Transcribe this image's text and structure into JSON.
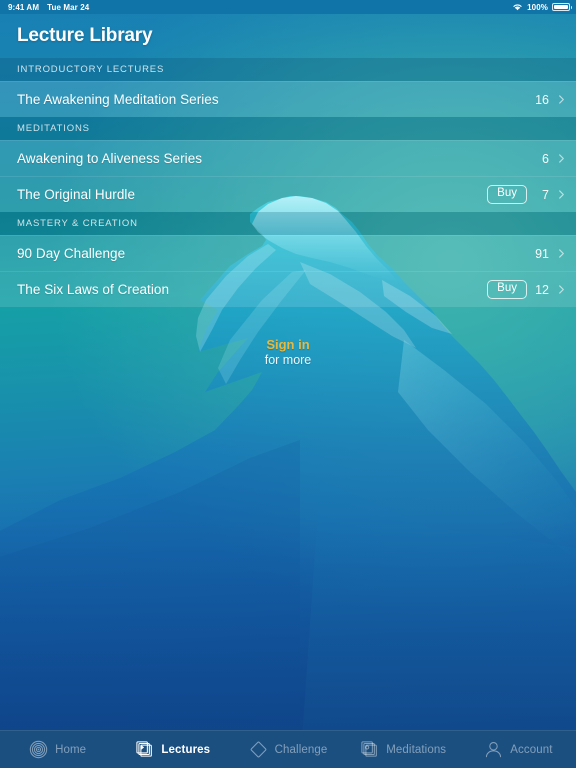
{
  "status_bar": {
    "time": "9:41 AM",
    "date": "Tue Mar 24",
    "battery_percent": "100%",
    "wifi_icon": "wifi-icon",
    "battery_icon": "battery-full-icon"
  },
  "header": {
    "title": "Lecture Library"
  },
  "sections": [
    {
      "title": "INTRODUCTORY LECTURES",
      "rows": [
        {
          "title": "The Awakening Meditation Series",
          "count": "16",
          "buy_label": null,
          "chevron": "chevron-right-icon"
        }
      ]
    },
    {
      "title": "MEDITATIONS",
      "rows": [
        {
          "title": "Awakening to Aliveness Series",
          "count": "6",
          "buy_label": null,
          "chevron": "chevron-right-icon"
        },
        {
          "title": "The Original Hurdle",
          "count": "7",
          "buy_label": "Buy",
          "chevron": "chevron-right-icon"
        }
      ]
    },
    {
      "title": "MASTERY & CREATION",
      "rows": [
        {
          "title": "90 Day Challenge",
          "count": "91",
          "buy_label": null,
          "chevron": "chevron-right-icon"
        },
        {
          "title": "The Six Laws of Creation",
          "count": "12",
          "buy_label": "Buy",
          "chevron": "chevron-right-icon"
        }
      ]
    }
  ],
  "signin": {
    "link_label": "Sign in",
    "sub_label": "for more",
    "link_color": "#e7b93f"
  },
  "tabbar": {
    "items": [
      {
        "label": "Home",
        "icon": "concentric-circles-icon",
        "active": false
      },
      {
        "label": "Lectures",
        "icon": "stacked-cards-play-icon",
        "active": true
      },
      {
        "label": "Challenge",
        "icon": "diamond-outline-icon",
        "active": false
      },
      {
        "label": "Meditations",
        "icon": "stacked-cards-icon",
        "active": false
      },
      {
        "label": "Account",
        "icon": "person-icon",
        "active": false
      }
    ]
  },
  "theme": {
    "tabbar_bg": "#1b4f80",
    "statusbar_bg": "#1174a8",
    "accent": "#e7b93f"
  }
}
